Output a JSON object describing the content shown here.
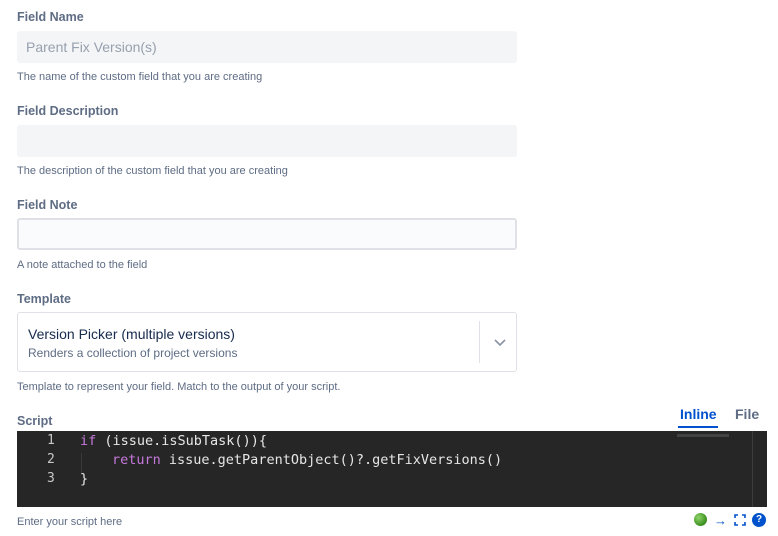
{
  "field_name": {
    "label": "Field Name",
    "placeholder": "Parent Fix Version(s)",
    "help": "The name of the custom field that you are creating"
  },
  "field_description": {
    "label": "Field Description",
    "value": "",
    "help": "The description of the custom field that you are creating"
  },
  "field_note": {
    "label": "Field Note",
    "value": "",
    "help": "A note attached to the field"
  },
  "template": {
    "label": "Template",
    "selected_title": "Version Picker (multiple versions)",
    "selected_description": "Renders a collection of project versions",
    "help": "Template to represent your field. Match to the output of your script."
  },
  "script": {
    "label": "Script",
    "tabs": [
      {
        "label": "Inline",
        "active": true
      },
      {
        "label": "File",
        "active": false
      }
    ],
    "line_numbers": [
      "1",
      "2",
      "3"
    ],
    "code_lines": [
      {
        "keyword": "if",
        "rest": " (issue.isSubTask()){"
      },
      {
        "keyword": "return",
        "rest": " issue.getParentObject()?.getFixVersions()"
      },
      {
        "keyword": "",
        "rest": "}"
      }
    ],
    "help": "Enter your script here",
    "icons": [
      "status-ok-icon",
      "arrow-right-icon",
      "expand-icon",
      "help-icon"
    ],
    "help_icon_glyph": "?",
    "arrow_glyph": "→"
  },
  "colors": {
    "accent": "#0052cc",
    "editor_bg": "#262626",
    "keyword": "#c678dd"
  }
}
